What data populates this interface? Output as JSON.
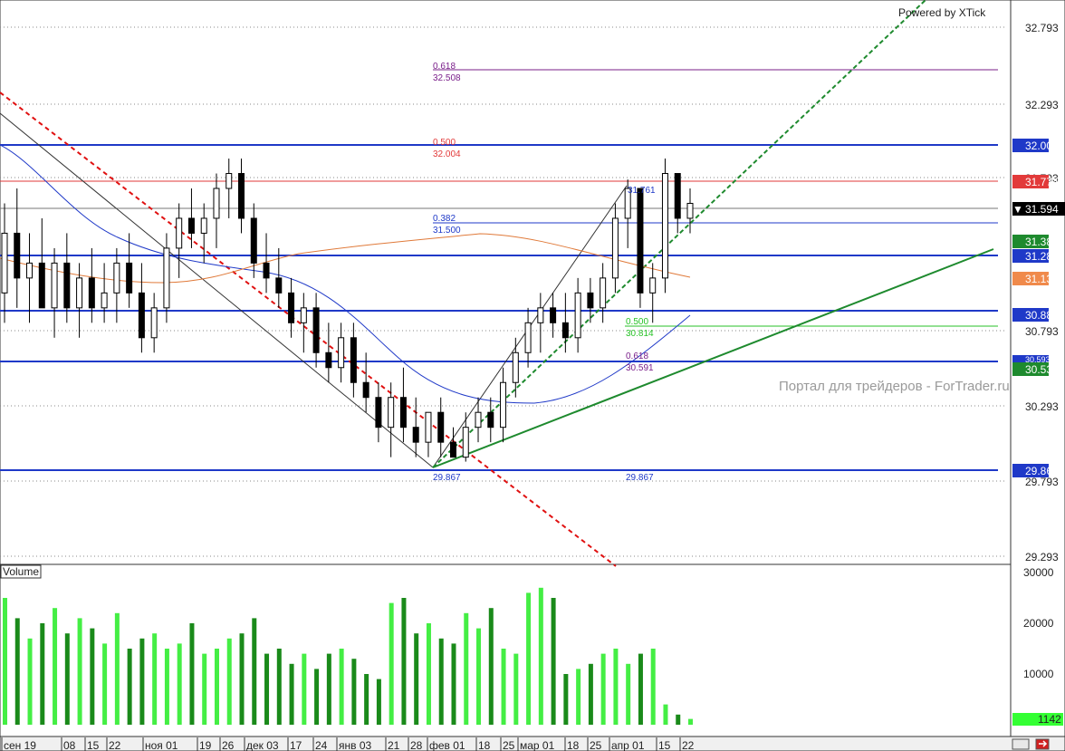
{
  "chart_data": {
    "type": "candlestick",
    "watermark_top": "Powered by XTick",
    "watermark_mid": "Портал для трейдеров - ForTrader.ru",
    "volume_label": "Volume",
    "price_axis": {
      "ticks": [
        "32.793",
        "32.293",
        "31.793",
        "30.793",
        "30.293",
        "29.793",
        "29.293"
      ],
      "ylim": [
        29.2,
        32.95
      ]
    },
    "volume_axis": {
      "ticks": [
        "30000",
        "20000",
        "10000"
      ],
      "ylim": [
        0,
        30000
      ]
    },
    "x_ticks": [
      "сен 19",
      "08",
      "15",
      "22",
      "ноя 01",
      "19",
      "26",
      "дек 03",
      "17",
      "24",
      "янв 03",
      "21",
      "28",
      "фев 01",
      "18",
      "25",
      "мар 01",
      "18",
      "25",
      "апр 01",
      "15",
      "22"
    ],
    "price_tags": [
      {
        "label": "32.007",
        "color": "#1f39c8"
      },
      {
        "label": "31.774",
        "color": "#e23a3a"
      },
      {
        "label": "31.594",
        "color": "#000000"
      },
      {
        "label": "31.382",
        "color": "#1e8a2e"
      },
      {
        "label": "31.282",
        "color": "#1f39c8"
      },
      {
        "label": "31.132",
        "color": "#f08a4b"
      },
      {
        "label": "30.889",
        "color": "#1f39c8"
      },
      {
        "label": "30.593",
        "color": "#1f39c8"
      },
      {
        "label": "30.535",
        "color": "#1e8a2e"
      },
      {
        "label": "29.865",
        "color": "#1f39c8"
      }
    ],
    "volume_tag": {
      "label": "1142",
      "color": "#33ff33"
    },
    "fib_labels": [
      {
        "ratio": "0.618",
        "price": "32.508",
        "color": "#7a1f8a"
      },
      {
        "ratio": "0.500",
        "price": "32.004",
        "color": "#e23a3a"
      },
      {
        "ratio": "0.382",
        "price": "31.500",
        "color": "#1f39c8"
      },
      {
        "ratio": "0.500",
        "price": "30.814",
        "color": "#27c227"
      },
      {
        "ratio": "0.618",
        "price": "30.591",
        "color": "#7a1f8a"
      }
    ],
    "extreme_labels": [
      "31.761",
      "29.867",
      "29.867"
    ],
    "series": [
      {
        "name": "price",
        "ohlc": [
          [
            31.0,
            31.6,
            30.8,
            31.4
          ],
          [
            31.4,
            31.7,
            30.9,
            31.1
          ],
          [
            31.1,
            31.4,
            30.8,
            31.2
          ],
          [
            31.2,
            31.5,
            30.9,
            30.9
          ],
          [
            30.9,
            31.3,
            30.7,
            31.2
          ],
          [
            31.2,
            31.4,
            30.8,
            30.9
          ],
          [
            30.9,
            31.2,
            30.7,
            31.1
          ],
          [
            31.1,
            31.3,
            30.8,
            30.9
          ],
          [
            30.9,
            31.2,
            30.8,
            31.0
          ],
          [
            31.0,
            31.3,
            30.8,
            31.2
          ],
          [
            31.2,
            31.4,
            30.9,
            31.0
          ],
          [
            31.0,
            31.2,
            30.6,
            30.7
          ],
          [
            30.7,
            31.0,
            30.6,
            30.9
          ],
          [
            30.9,
            31.4,
            30.8,
            31.3
          ],
          [
            31.3,
            31.6,
            31.1,
            31.5
          ],
          [
            31.5,
            31.7,
            31.3,
            31.4
          ],
          [
            31.4,
            31.6,
            31.2,
            31.5
          ],
          [
            31.5,
            31.8,
            31.3,
            31.7
          ],
          [
            31.7,
            31.9,
            31.5,
            31.8
          ],
          [
            31.8,
            31.9,
            31.4,
            31.5
          ],
          [
            31.5,
            31.6,
            31.1,
            31.2
          ],
          [
            31.2,
            31.4,
            31.0,
            31.1
          ],
          [
            31.1,
            31.3,
            30.9,
            31.0
          ],
          [
            31.0,
            31.1,
            30.7,
            30.8
          ],
          [
            30.8,
            31.0,
            30.6,
            30.9
          ],
          [
            30.9,
            31.0,
            30.5,
            30.6
          ],
          [
            30.6,
            30.8,
            30.4,
            30.5
          ],
          [
            30.5,
            30.8,
            30.4,
            30.7
          ],
          [
            30.7,
            30.8,
            30.3,
            30.4
          ],
          [
            30.4,
            30.6,
            30.2,
            30.3
          ],
          [
            30.3,
            30.4,
            30.0,
            30.1
          ],
          [
            30.1,
            30.4,
            29.9,
            30.3
          ],
          [
            30.3,
            30.5,
            30.0,
            30.1
          ],
          [
            30.1,
            30.3,
            29.9,
            30.0
          ],
          [
            30.0,
            30.2,
            29.9,
            30.2
          ],
          [
            30.2,
            30.3,
            29.9,
            30.0
          ],
          [
            30.0,
            30.1,
            29.9,
            29.9
          ],
          [
            29.9,
            30.2,
            29.87,
            30.1
          ],
          [
            30.1,
            30.3,
            30.0,
            30.2
          ],
          [
            30.2,
            30.3,
            30.0,
            30.1
          ],
          [
            30.1,
            30.5,
            30.0,
            30.4
          ],
          [
            30.4,
            30.7,
            30.3,
            30.6
          ],
          [
            30.6,
            30.9,
            30.5,
            30.8
          ],
          [
            30.8,
            31.0,
            30.6,
            30.9
          ],
          [
            30.9,
            31.0,
            30.7,
            30.8
          ],
          [
            30.8,
            31.0,
            30.6,
            30.7
          ],
          [
            30.7,
            31.1,
            30.6,
            31.0
          ],
          [
            31.0,
            31.1,
            30.8,
            30.9
          ],
          [
            30.9,
            31.2,
            30.8,
            31.1
          ],
          [
            31.1,
            31.6,
            31.0,
            31.5
          ],
          [
            31.5,
            31.76,
            31.3,
            31.7
          ],
          [
            31.7,
            31.7,
            30.9,
            31.0
          ],
          [
            31.0,
            31.2,
            30.8,
            31.1
          ],
          [
            31.1,
            31.9,
            31.0,
            31.8
          ],
          [
            31.8,
            31.8,
            31.4,
            31.5
          ],
          [
            31.5,
            31.7,
            31.4,
            31.6
          ]
        ]
      },
      {
        "name": "volume",
        "values": [
          25000,
          21000,
          17000,
          20000,
          23000,
          18000,
          21000,
          19000,
          16000,
          22000,
          15000,
          17000,
          18000,
          15000,
          16000,
          20000,
          14000,
          15000,
          17000,
          18000,
          21000,
          14000,
          15000,
          12000,
          14000,
          11000,
          14000,
          15000,
          13000,
          10000,
          9000,
          24000,
          25000,
          18000,
          20000,
          17000,
          16000,
          22000,
          19000,
          23000,
          15000,
          14000,
          26000,
          27000,
          25000,
          10000,
          11000,
          12000,
          14000,
          15000,
          12000,
          14000,
          15000,
          4000,
          2000,
          1142
        ]
      }
    ]
  }
}
